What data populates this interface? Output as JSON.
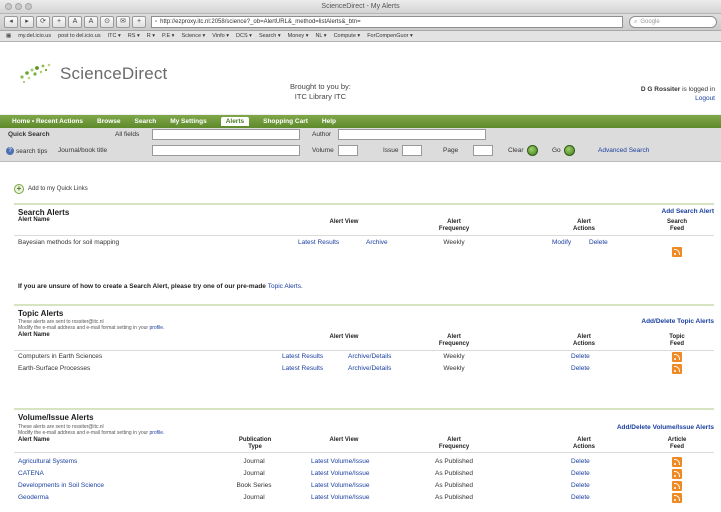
{
  "browser": {
    "window_title": "ScienceDirect - My Alerts",
    "buttons": [
      "◂",
      "▸",
      "⟳",
      "+",
      "A",
      "A",
      "⊙",
      "✉",
      "+"
    ],
    "url": "http://ezproxy.itc.nl:2058/science?_ob=AlertURL&_method=listAlerts&_btn=",
    "search_placeholder": "Google",
    "bookmarks": [
      "my.del.icio.us",
      "post to del.icio.us",
      "ITC ▾",
      "RS ▾",
      "R ▾",
      "P.E ▾",
      "Science ▾",
      "Vinfo ▾",
      "DCS ▾",
      "Search ▾",
      "Money ▾",
      "NL ▾",
      "Compute ▾",
      "ForCompenGuor ▾"
    ]
  },
  "header": {
    "logo": "ScienceDirect",
    "brought_line1": "Brought to you by:",
    "brought_line2": "ITC Library ITC",
    "user": "D G Rossiter",
    "logged": "is logged in",
    "logout": "Logout"
  },
  "nav": [
    "Home • Recent Actions",
    "Browse",
    "Search",
    "My Settings",
    "Alerts",
    "Shopping Cart",
    "Help"
  ],
  "quick_search": {
    "title": "Quick Search",
    "all_fields": "All fields",
    "author": "Author",
    "search_tips": "search tips",
    "journal": "Journal/book title",
    "volume": "Volume",
    "issue": "Issue",
    "page": "Page",
    "clear": "Clear",
    "go": "Go",
    "advanced": "Advanced Search"
  },
  "quick_links": "Add to my Quick Links",
  "search_alerts": {
    "title": "Search Alerts",
    "action": "Add Search Alert",
    "headers": {
      "name": "Alert Name",
      "view": "Alert View",
      "freq": "Alert Frequency",
      "actions": "Alert Actions",
      "feed": "Search Feed"
    },
    "rows": [
      {
        "name": "Bayesian methods for soil mapping",
        "view1": "Latest Results",
        "view2": "Archive",
        "freq": "Weekly",
        "act1": "Modify",
        "act2": "Delete"
      }
    ]
  },
  "premade": {
    "text": "If you are unsure of how to create a Search Alert, please try one of our pre-made",
    "link": "Topic Alerts."
  },
  "topic_alerts": {
    "title": "Topic Alerts",
    "sub1": "These alerts are sent to rossiter@itc.nl",
    "sub2": "Modify the e-mail address and e-mail format setting in your",
    "sub_link": "profile.",
    "action": "Add/Delete Topic Alerts",
    "headers": {
      "name": "Alert Name",
      "view": "Alert View",
      "freq": "Alert Frequency",
      "actions": "Alert Actions",
      "feed": "Topic Feed"
    },
    "rows": [
      {
        "name": "Computers in Earth Sciences",
        "view1": "Latest Results",
        "view2": "Archive/Details",
        "freq": "Weekly",
        "act": "Delete"
      },
      {
        "name": "Earth-Surface Processes",
        "view1": "Latest Results",
        "view2": "Archive/Details",
        "freq": "Weekly",
        "act": "Delete"
      }
    ]
  },
  "volume_alerts": {
    "title": "Volume/Issue Alerts",
    "sub1": "These alerts are sent to rossiter@itc.nl",
    "sub2": "Modify the e-mail address and e-mail format setting in your",
    "sub_link": "profile.",
    "action": "Add/Delete Volume/Issue Alerts",
    "headers": {
      "name": "Alert Name",
      "type": "Publication Type",
      "view": "Alert View",
      "freq": "Alert Frequency",
      "actions": "Alert Actions",
      "feed": "Article Feed"
    },
    "rows": [
      {
        "name": "Agricultural Systems",
        "type": "Journal",
        "view": "Latest Volume/Issue",
        "freq": "As Published",
        "act": "Delete"
      },
      {
        "name": "CATENA",
        "type": "Journal",
        "view": "Latest Volume/Issue",
        "freq": "As Published",
        "act": "Delete"
      },
      {
        "name": "Developments in Soil Science",
        "type": "Book Series",
        "view": "Latest Volume/Issue",
        "freq": "As Published",
        "act": "Delete"
      },
      {
        "name": "Geoderma",
        "type": "Journal",
        "view": "Latest Volume/Issue",
        "freq": "As Published",
        "act": "Delete"
      }
    ]
  }
}
